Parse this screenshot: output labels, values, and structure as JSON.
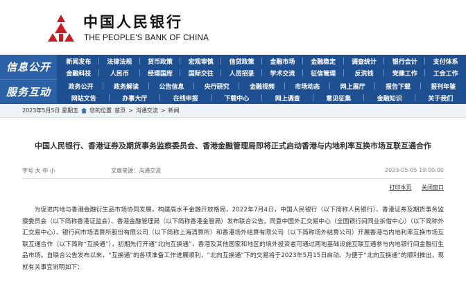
{
  "header": {
    "bank_cn": "中国人民银行",
    "bank_en": "THE PEOPLE'S BANK OF CHINA",
    "logo_icon": "pboc-emblem-icon",
    "logo_color": "#c81d25"
  },
  "nav": {
    "label_1": "信息公开",
    "label_2": "服务互动",
    "rows": [
      [
        "新闻发布",
        "法律法规",
        "货币政策",
        "宏观审慎",
        "信贷政策",
        "金融市场",
        "金融稳定",
        "调查统计",
        "银行会计",
        "支付体系"
      ],
      [
        "金融科技",
        "人民币",
        "经理国库",
        "国际交往",
        "人员招录",
        "学术交流",
        "征信管理",
        "反洗钱",
        "党建工作",
        "工会工作"
      ],
      [
        "政务公开",
        "政务解读",
        "公告信息",
        "央行研究",
        "金融视频",
        "市场动态",
        "网上展厅",
        "报告下载",
        "报刊年鉴"
      ],
      [
        "网站文告",
        "办事大厅",
        "在线申报",
        "下载中心",
        "网上调查",
        "意见征集",
        "金融知识",
        "关于我们"
      ]
    ]
  },
  "breadcrumb": {
    "date": "2023年5月5日 星期五",
    "location_label": "您的位置",
    "items": [
      "首页",
      "沟通交流",
      "新闻"
    ]
  },
  "article": {
    "title": "中国人民银行、香港证券及期货事务监察委员会、香港金融管理局即将正式启动香港与内地利率互换市场互联互通合作",
    "meta_left": "字号  大  中  小",
    "meta_source": "文章来源：沟通交流",
    "date": "2023-05-05 19:00:00",
    "print_label": "打印本页",
    "close_label": "关闭窗口",
    "paragraph": "为促进内地与香港金融衍生品市场协同发展，构建高水平金融开放格局，2022年7月4日，中国人民银行（以下简称人民银行）、香港证券及期货事务监察委员会（以下简称香港证监会）、香港金融管理局（以下简称香港金管局）发布联合公告，同意中国外汇交易中心（全国银行间同业拆借中心）（以下简称外汇交易中心）、银行间市场清算所股份有限公司（以下简称上海清算所）和香港场外结算有限公司（以下简称场外结算公司）开展香港与内地利率互换市场互联互通合作（以下简称“互换通”），初期先行开通“北向互换通”，香港及其他国家和地区的境外投资者可通过两地基础设施互联互通参与内地银行间金融衍生品市场。自联合公告发布以来，“互换通”的各项准备工作进展顺利，“北向互换通”下的交易将于2023年5月15日启动。为便于“北向互换通”的顺利推出，现就有关事宜说明如下："
  }
}
